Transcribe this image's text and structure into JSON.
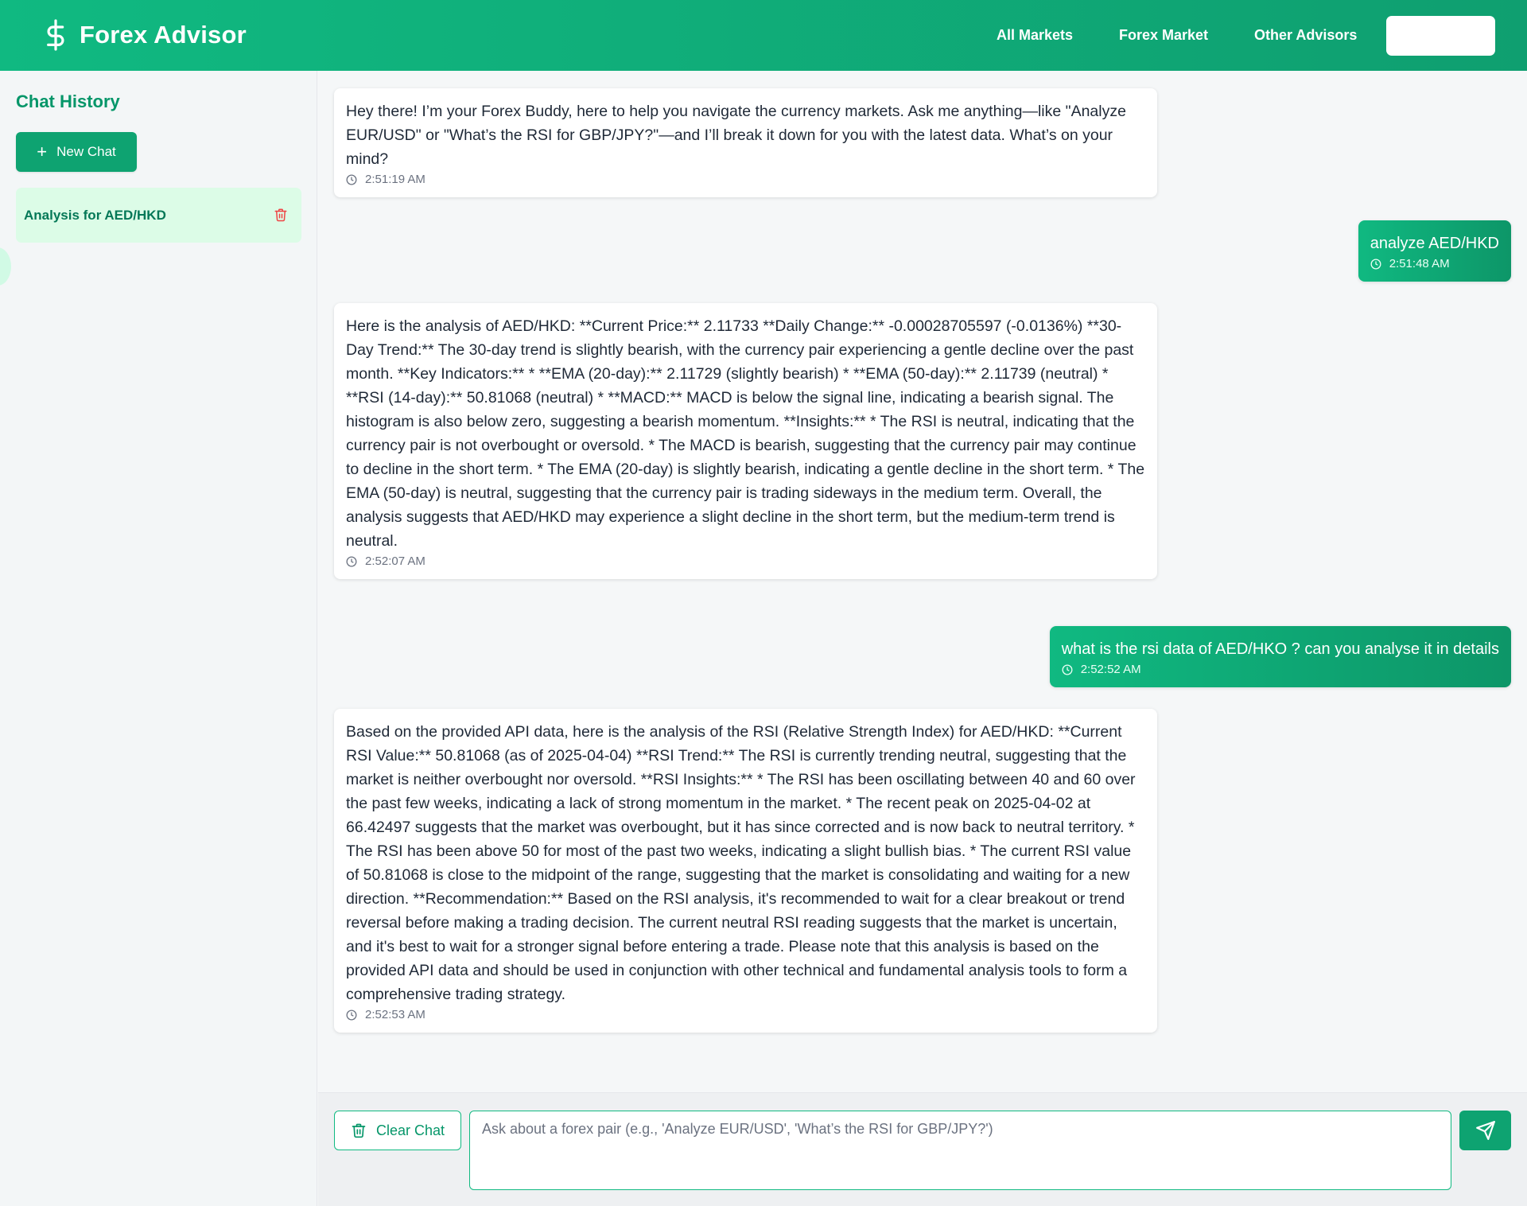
{
  "header": {
    "brand_title": "Forex Advisor",
    "brand_icon": "dollar-sign-icon",
    "nav": [
      {
        "label": "All Markets"
      },
      {
        "label": "Forex Market"
      },
      {
        "label": "Other Advisors"
      }
    ],
    "nav_button_label": ""
  },
  "sidebar": {
    "title": "Chat History",
    "new_chat_label": "New Chat",
    "items": [
      {
        "label": "Analysis for AED/HKD"
      }
    ]
  },
  "messages": [
    {
      "role": "bot",
      "text": "Hey there! I’m your Forex Buddy, here to help you navigate the currency markets. Ask me anything—like \"Analyze EUR/USD\" or \"What’s the RSI for GBP/JPY?\"—and I’ll break it down for you with the latest data. What’s on your mind?",
      "time": "2:51:19 AM"
    },
    {
      "role": "user",
      "text": "analyze AED/HKD",
      "time": "2:51:48 AM"
    },
    {
      "role": "bot",
      "text": "Here is the analysis of AED/HKD: **Current Price:** 2.11733 **Daily Change:** -0.00028705597 (-0.0136%) **30-Day Trend:** The 30-day trend is slightly bearish, with the currency pair experiencing a gentle decline over the past month. **Key Indicators:** * **EMA (20-day):** 2.11729 (slightly bearish) * **EMA (50-day):** 2.11739 (neutral) * **RSI (14-day):** 50.81068 (neutral) * **MACD:** MACD is below the signal line, indicating a bearish signal. The histogram is also below zero, suggesting a bearish momentum. **Insights:** * The RSI is neutral, indicating that the currency pair is not overbought or oversold. * The MACD is bearish, suggesting that the currency pair may continue to decline in the short term. * The EMA (20-day) is slightly bearish, indicating a gentle decline in the short term. * The EMA (50-day) is neutral, suggesting that the currency pair is trading sideways in the medium term. Overall, the analysis suggests that AED/HKD may experience a slight decline in the short term, but the medium-term trend is neutral.",
      "time": "2:52:07 AM"
    },
    {
      "role": "user",
      "text": "what is the rsi data of AED/HKO ? can you analyse it in details",
      "time": "2:52:52 AM"
    },
    {
      "role": "bot",
      "text": "Based on the provided API data, here is the analysis of the RSI (Relative Strength Index) for AED/HKD: **Current RSI Value:** 50.81068 (as of 2025-04-04) **RSI Trend:** The RSI is currently trending neutral, suggesting that the market is neither overbought nor oversold. **RSI Insights:** * The RSI has been oscillating between 40 and 60 over the past few weeks, indicating a lack of strong momentum in the market. * The recent peak on 2025-04-02 at 66.42497 suggests that the market was overbought, but it has since corrected and is now back to neutral territory. * The RSI has been above 50 for most of the past two weeks, indicating a slight bullish bias. * The current RSI value of 50.81068 is close to the midpoint of the range, suggesting that the market is consolidating and waiting for a new direction. **Recommendation:** Based on the RSI analysis, it's recommended to wait for a clear breakout or trend reversal before making a trading decision. The current neutral RSI reading suggests that the market is uncertain, and it's best to wait for a stronger signal before entering a trade. Please note that this analysis is based on the provided API data and should be used in conjunction with other technical and fundamental analysis tools to form a comprehensive trading strategy.",
      "time": "2:52:53 AM"
    }
  ],
  "composer": {
    "clear_label": "Clear Chat",
    "input_value": "",
    "input_placeholder": "Ask about a forex pair (e.g., 'Analyze EUR/USD', 'What’s the RSI for GBP/JPY?')"
  },
  "colors": {
    "brand_green": "#10b981",
    "dark_green": "#059669",
    "active_item_bg": "#dcfce7",
    "delete_red": "#ef4444"
  }
}
